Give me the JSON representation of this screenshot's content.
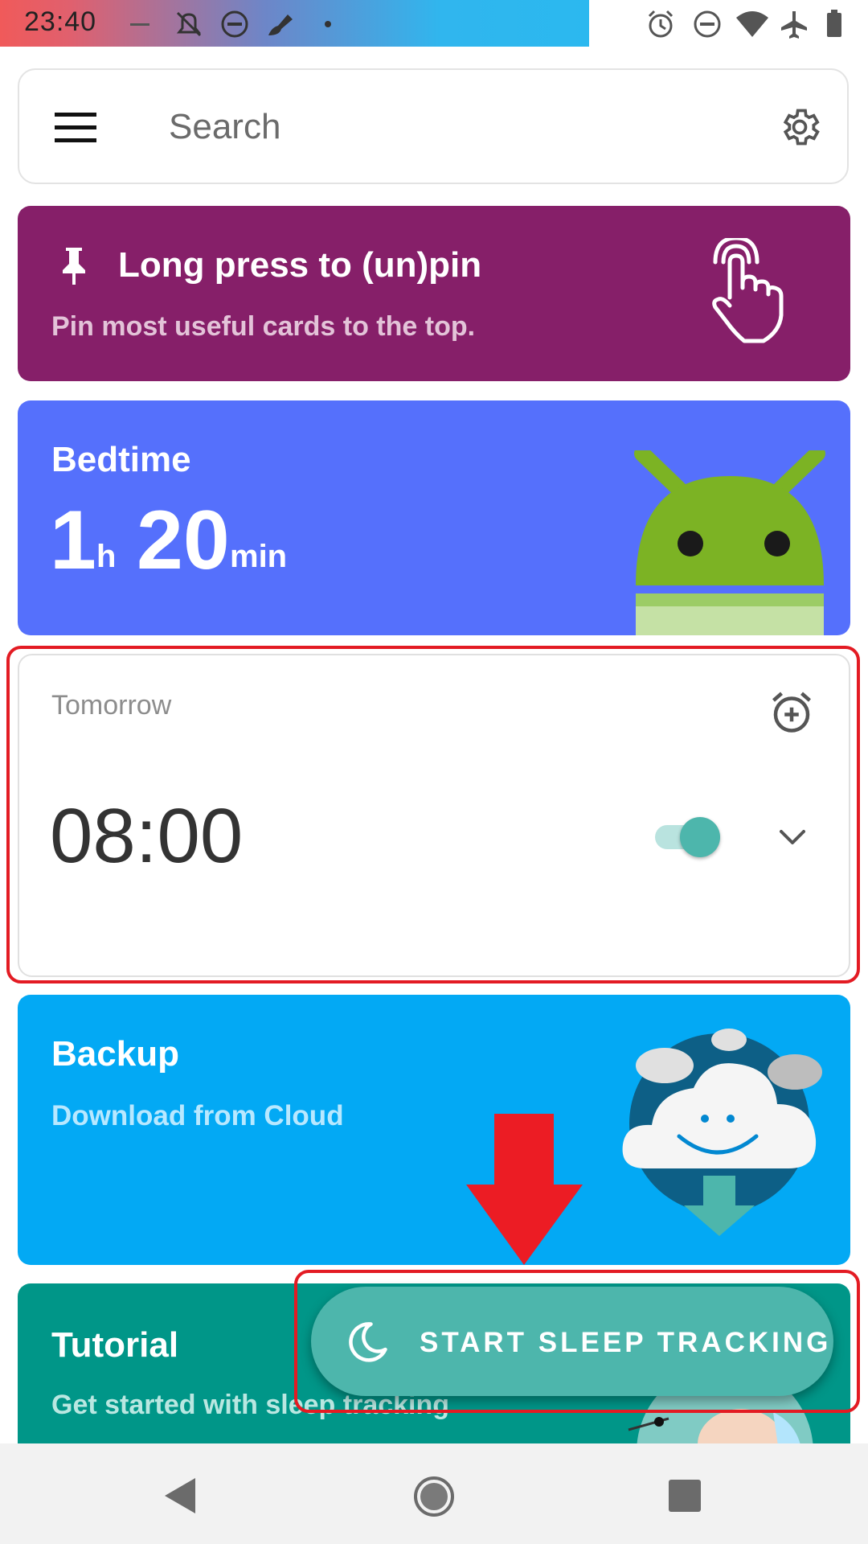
{
  "status_bar": {
    "time": "23:40"
  },
  "search": {
    "placeholder": "Search"
  },
  "cards": {
    "pin": {
      "title": "Long press to (un)pin",
      "subtitle": "Pin most useful cards to the top."
    },
    "bedtime": {
      "label": "Bedtime",
      "hours": "1",
      "hours_unit": "h",
      "minutes": "20",
      "minutes_unit": "min"
    },
    "alarm": {
      "day": "Tomorrow",
      "time": "08:00",
      "enabled": true
    },
    "backup": {
      "title": "Backup",
      "subtitle": "Download from Cloud"
    },
    "tutorial": {
      "title": "Tutorial",
      "subtitle": "Get started with sleep tracking"
    }
  },
  "fab": {
    "label": "START SLEEP TRACKING"
  },
  "colors": {
    "pin_card": "#861f69",
    "bedtime_card": "#5570fc",
    "backup_card": "#03a9f4",
    "tutorial_card": "#009688",
    "fab": "#4db6ac",
    "highlight": "#e31b23"
  },
  "icons": [
    "menu-icon",
    "settings-icon",
    "pin-icon",
    "touch-gesture-icon",
    "android-mascot",
    "add-alarm-icon",
    "chevron-down-icon",
    "cloud-download-illustration",
    "moon-icon",
    "back-icon",
    "home-icon",
    "recents-icon"
  ]
}
